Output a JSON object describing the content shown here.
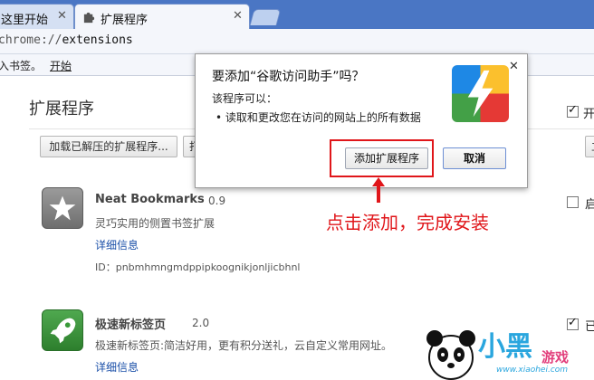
{
  "tabs": [
    {
      "title": "这里开始",
      "close": "✕"
    },
    {
      "title": "扩展程序",
      "close": "✕"
    }
  ],
  "omnibox": {
    "scheme": "chrome://",
    "host": "extensions"
  },
  "bookmarks": {
    "prompt": "入书签。",
    "link": "开始"
  },
  "page": {
    "title": "扩展程序",
    "dev_mode_label": "开",
    "load_button": "加载已解压的扩展程序...",
    "pack_button": "打",
    "update_button": "立"
  },
  "extensions": [
    {
      "name": "Neat Bookmarks",
      "version": "0.9",
      "description": "灵巧实用的侧置书签扩展",
      "details_link": "详细信息",
      "id": "ID：pnbmhmngmdppipkoognikjonljicbhnl",
      "enable_label": "启",
      "enabled": false,
      "icon": "star-icon"
    },
    {
      "name": "极速新标签页",
      "version": "2.0",
      "description": "极速新标签页:简洁好用，更有积分送礼，云自定义常用网址。",
      "details_link": "详细信息",
      "enable_label": "已",
      "enabled": true,
      "icon": "rocket-icon"
    }
  ],
  "dialog": {
    "title": "要添加“谷歌访问助手”吗？",
    "can_label": "该程序可以：",
    "permission": "•  读取和更改您在访问的网站上的所有数据",
    "add_button": "添加扩展程序",
    "cancel_button": "取消",
    "close": "✕",
    "icon": "lightning-logo-icon"
  },
  "annotation": {
    "text": "点击添加，完成安装",
    "color": "#e0161a"
  },
  "watermark": {
    "brand": "小黑",
    "game": "游戏",
    "url": "www.xiaohei.com"
  }
}
